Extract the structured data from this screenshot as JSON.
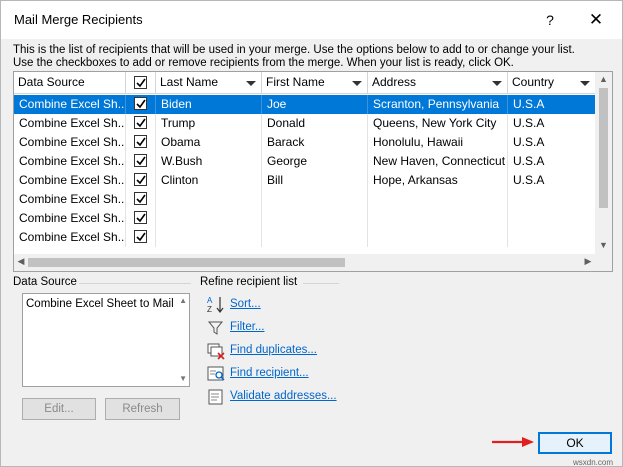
{
  "window": {
    "title": "Mail Merge Recipients",
    "help_glyph": "?",
    "close_glyph": "✕"
  },
  "intro": {
    "line1": "This is the list of recipients that will be used in your merge.  Use the options below to add to or change your list.",
    "line2": "Use the checkboxes to add or remove recipients from the merge.  When your list is ready, click OK."
  },
  "grid": {
    "headers": [
      "Data Source",
      "",
      "Last Name",
      "First Name",
      "Address",
      "Country"
    ],
    "rows": [
      {
        "source": "Combine Excel Sh...",
        "checked": true,
        "last": "Biden",
        "first": "Joe",
        "address": "Scranton, Pennsylvania",
        "country": "U.S.A",
        "selected": true
      },
      {
        "source": "Combine Excel Sh...",
        "checked": true,
        "last": "Trump",
        "first": "Donald",
        "address": "Queens, New York City",
        "country": "U.S.A",
        "selected": false
      },
      {
        "source": "Combine Excel Sh...",
        "checked": true,
        "last": "Obama",
        "first": "Barack",
        "address": "Honolulu, Hawaii",
        "country": "U.S.A",
        "selected": false
      },
      {
        "source": "Combine Excel Sh...",
        "checked": true,
        "last": "W.Bush",
        "first": "George",
        "address": "New Haven, Connecticut",
        "country": "U.S.A",
        "selected": false
      },
      {
        "source": "Combine Excel Sh...",
        "checked": true,
        "last": "Clinton",
        "first": "Bill",
        "address": "Hope, Arkansas",
        "country": "U.S.A",
        "selected": false
      },
      {
        "source": "Combine Excel Sh...",
        "checked": true,
        "last": "",
        "first": "",
        "address": "",
        "country": "",
        "selected": false
      },
      {
        "source": "Combine Excel Sh...",
        "checked": true,
        "last": "",
        "first": "",
        "address": "",
        "country": "",
        "selected": false
      },
      {
        "source": "Combine Excel Sh...",
        "checked": true,
        "last": "",
        "first": "",
        "address": "",
        "country": "",
        "selected": false
      }
    ]
  },
  "data_source": {
    "label": "Data Source",
    "items": [
      "Combine Excel Sheet to Mail"
    ],
    "edit_label": "Edit...",
    "refresh_label": "Refresh"
  },
  "refine": {
    "label": "Refine recipient list",
    "items": [
      {
        "label": "Sort...",
        "icon": "sort-az-icon"
      },
      {
        "label": "Filter...",
        "icon": "filter-icon"
      },
      {
        "label": "Find duplicates...",
        "icon": "find-duplicates-icon"
      },
      {
        "label": "Find recipient...",
        "icon": "find-recipient-icon"
      },
      {
        "label": "Validate addresses...",
        "icon": "validate-addresses-icon"
      }
    ]
  },
  "ok_label": "OK",
  "watermark": "wsxdn.com",
  "colors": {
    "selection": "#0078d7",
    "link": "#0066cc",
    "annotation_arrow": "#e02020"
  }
}
